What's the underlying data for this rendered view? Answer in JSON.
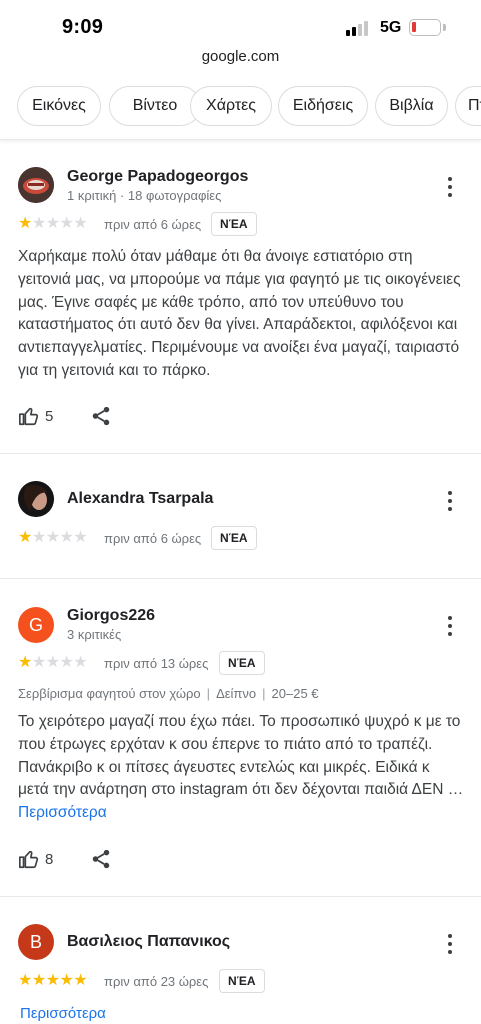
{
  "status_bar": {
    "time": "9:09",
    "network": "5G",
    "signal_bars": 2,
    "battery_level": 0.1
  },
  "browser": {
    "url": "google.com"
  },
  "chips": [
    "Εικόνες",
    "Βίντεο",
    "Χάρτες",
    "Ειδήσεις",
    "Βιβλία",
    "Πτ"
  ],
  "reviews": [
    {
      "name": "George Papadogeorgos",
      "subtitle": "1 κριτική · 18 φωτογραφίες",
      "rating": 1,
      "time": "πριν από 6 ώρες",
      "badge": "ΝΈΑ",
      "text": "Χαρήκαμε πολύ όταν μάθαμε ότι θα άνοιγε εστιατόριο στη γειτονιά μας, να μπορούμε να πάμε για φαγητό με τις οικογένειες μας. Έγινε σαφές με κάθε τρόπο, από τον υπεύθυνο του καταστήματος ότι αυτό δεν θα γίνει. Απαράδεκτοι, αφιλόξενοι και αντιεπαγγελματίες. Περιμένουμε να ανοίξει ένα μαγαζί, ταιριαστό για τη γειτονιά και το πάρκο.",
      "likes": "5"
    },
    {
      "name": "Alexandra Tsarpala",
      "rating": 1,
      "time": "πριν από 6 ώρες",
      "badge": "ΝΈΑ"
    },
    {
      "name": "Giorgos226",
      "avatar_letter": "G",
      "avatar_color": "#f4511e",
      "subtitle": "3 κριτικές",
      "rating": 1,
      "time": "πριν από 13 ώρες",
      "badge": "ΝΈΑ",
      "meta": [
        "Σερβίρισμα φαγητού στον χώρο",
        "Δείπνο",
        "20–25 €"
      ],
      "text": "Το χειρότερο μαγαζί που έχω πάει. Το προσωπικό ψυχρό κ με το που έτρωγες ερχόταν κ σου έπερνε το πιάτο από το τραπέζι. Πανάκριβο κ οι πίτσες άγευστες εντελώς και μικρές. Ειδικά κ μετά την ανάρτηση στο instagram ότι δεν δέχονται παιδιά ΔΕΝ …",
      "more_label": "Περισσότερα",
      "likes": "8"
    },
    {
      "name": "Βασιλειος Παπανικος",
      "avatar_letter": "B",
      "avatar_color": "#c5391a",
      "rating": 5,
      "time": "πριν από 23 ώρες",
      "badge": "ΝΈΑ",
      "more_label": "Περισσότερα"
    }
  ],
  "colors": {
    "star_on": "#fbbc04",
    "star_off": "#dadce0",
    "link": "#1a73e8"
  },
  "icons": {
    "more": "more-vert-icon",
    "like": "thumb-up-icon",
    "share": "share-icon"
  }
}
